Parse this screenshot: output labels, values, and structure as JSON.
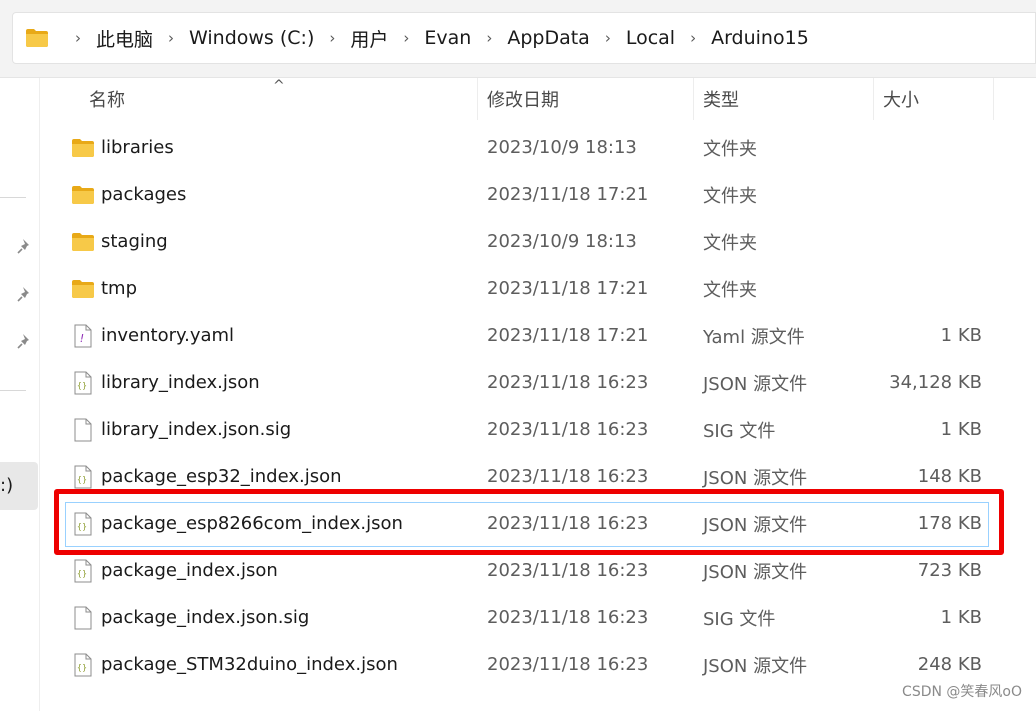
{
  "address_bar": {
    "crumbs": [
      "此电脑",
      "Windows (C:)",
      "用户",
      "Evan",
      "AppData",
      "Local",
      "Arduino15"
    ],
    "separator": "›"
  },
  "nav": {
    "selected_label": ":)"
  },
  "columns": {
    "name": "名称",
    "date": "修改日期",
    "type": "类型",
    "size": "大小",
    "sort_indicator": "^"
  },
  "files": [
    {
      "name": "libraries",
      "date": "2023/10/9 18:13",
      "type": "文件夹",
      "size": "",
      "icon": "folder-icon"
    },
    {
      "name": "packages",
      "date": "2023/11/18 17:21",
      "type": "文件夹",
      "size": "",
      "icon": "folder-icon"
    },
    {
      "name": "staging",
      "date": "2023/10/9 18:13",
      "type": "文件夹",
      "size": "",
      "icon": "folder-icon"
    },
    {
      "name": "tmp",
      "date": "2023/11/18 17:21",
      "type": "文件夹",
      "size": "",
      "icon": "folder-icon"
    },
    {
      "name": "inventory.yaml",
      "date": "2023/11/18 17:21",
      "type": "Yaml 源文件",
      "size": "1 KB",
      "icon": "yaml-file-icon"
    },
    {
      "name": "library_index.json",
      "date": "2023/11/18 16:23",
      "type": "JSON 源文件",
      "size": "34,128 KB",
      "icon": "json-file-icon"
    },
    {
      "name": "library_index.json.sig",
      "date": "2023/11/18 16:23",
      "type": "SIG 文件",
      "size": "1 KB",
      "icon": "blank-file-icon"
    },
    {
      "name": "package_esp32_index.json",
      "date": "2023/11/18 16:23",
      "type": "JSON 源文件",
      "size": "148 KB",
      "icon": "json-file-icon"
    },
    {
      "name": "package_esp8266com_index.json",
      "date": "2023/11/18 16:23",
      "type": "JSON 源文件",
      "size": "178 KB",
      "icon": "json-file-icon",
      "selected": true
    },
    {
      "name": "package_index.json",
      "date": "2023/11/18 16:23",
      "type": "JSON 源文件",
      "size": "723 KB",
      "icon": "json-file-icon"
    },
    {
      "name": "package_index.json.sig",
      "date": "2023/11/18 16:23",
      "type": "SIG 文件",
      "size": "1 KB",
      "icon": "blank-file-icon"
    },
    {
      "name": "package_STM32duino_index.json",
      "date": "2023/11/18 16:23",
      "type": "JSON 源文件",
      "size": "248 KB",
      "icon": "json-file-icon"
    }
  ],
  "watermark": "CSDN @笑春风oO",
  "colors": {
    "folder": "#f7c948",
    "folder_dark": "#e8a917",
    "highlight": "#ee0000",
    "selection_border": "#99d1ff"
  }
}
